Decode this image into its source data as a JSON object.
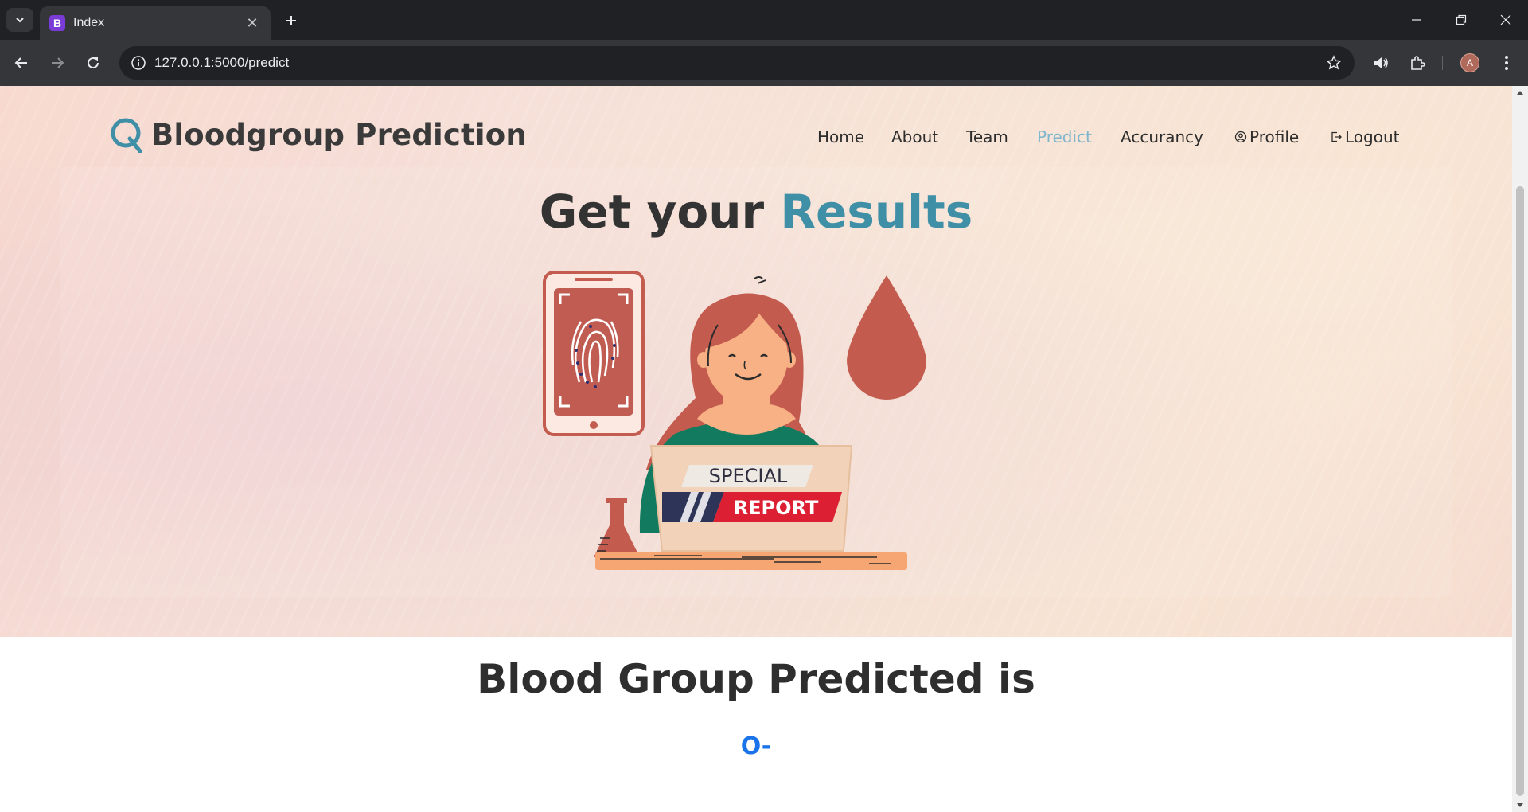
{
  "browser": {
    "tab_title": "Index",
    "tab_favicon_letter": "B",
    "url": "127.0.0.1:5000/predict",
    "avatar_letter": "A",
    "favicon_color": "#7a3bd6"
  },
  "site": {
    "brand_name": "Bloodgroup Prediction",
    "nav": {
      "home": "Home",
      "about": "About",
      "team": "Team",
      "predict": "Predict",
      "accuracy": "Accurancy",
      "profile": "Profile",
      "logout": "Logout"
    },
    "active_nav": "predict",
    "accent_color": "#3f8fa6",
    "active_nav_color": "#7fb6cd"
  },
  "hero": {
    "title_plain": "Get your ",
    "title_accent": "Results",
    "illustration": {
      "banner_top": "SPECIAL",
      "banner_bottom": "REPORT"
    }
  },
  "result": {
    "heading": "Blood Group Predicted is",
    "value": "O-",
    "value_color": "#1a73e8"
  }
}
